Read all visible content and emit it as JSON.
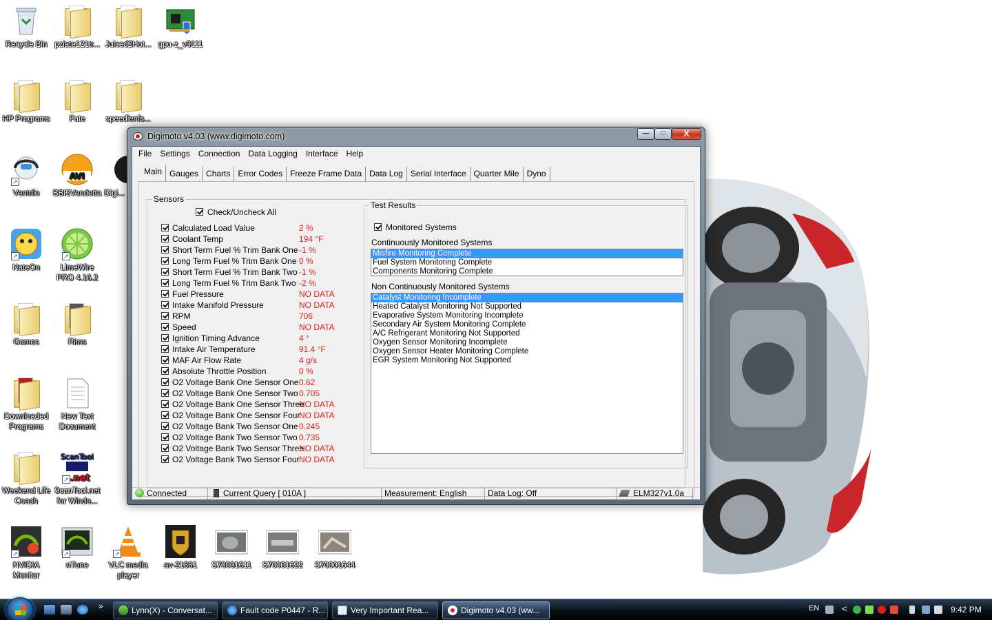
{
  "desktop": {
    "icons": [
      {
        "label": "Recycle Bin"
      },
      {
        "label": "pziate121tr..."
      },
      {
        "label": "Juiced2Hot..."
      },
      {
        "label": "gpu-z_v0111"
      },
      {
        "label": "HP Programs"
      },
      {
        "label": "Fate"
      },
      {
        "label": "speedlenfs..."
      },
      {
        "label": "Ventrilo"
      },
      {
        "label": "BBI2Vendetta"
      },
      {
        "label": "Digi..."
      },
      {
        "label": "NateOn"
      },
      {
        "label": "LimeWire PRO 4.16.2"
      },
      {
        "label": "Games"
      },
      {
        "label": "Rims"
      },
      {
        "label": "Downloaded Programs"
      },
      {
        "label": "New Text Document"
      },
      {
        "label": "Weekend Life Coach"
      },
      {
        "label": "ScanTool.net for Windo..."
      },
      {
        "label": "NVIDIA Monitor"
      },
      {
        "label": "nTune"
      },
      {
        "label": "VLC media player"
      },
      {
        "label": "av-21861"
      },
      {
        "label": "S70001611"
      },
      {
        "label": "S70001622"
      },
      {
        "label": "S70001644"
      }
    ],
    "icon_glyphs": {
      "avi": "AVI",
      "scantool_top": "ScanTool",
      "scantool_bottom": ".net"
    }
  },
  "window": {
    "title": "Digimoto v4.03 (www.digimoto.com)",
    "controls": {
      "minimize": "—",
      "maximize": "□",
      "close": "X"
    }
  },
  "menu": [
    "File",
    "Settings",
    "Connection",
    "Data Logging",
    "Interface",
    "Help"
  ],
  "tabs": [
    "Main",
    "Gauges",
    "Charts",
    "Error Codes",
    "Freeze Frame Data",
    "Data Log",
    "Serial Interface",
    "Quarter Mile",
    "Dyno"
  ],
  "sensors": {
    "group_label": "Sensors",
    "check_all_label": "Check/Uncheck All",
    "items": [
      {
        "name": "Calculated Load Value",
        "value": "2 %"
      },
      {
        "name": "Coolant Temp",
        "value": "194 °F"
      },
      {
        "name": "Short Term Fuel % Trim Bank One",
        "value": "-1 %"
      },
      {
        "name": "Long Term Fuel % Trim Bank One",
        "value": "0 %"
      },
      {
        "name": "Short Term Fuel % Trim Bank Two",
        "value": "-1 %"
      },
      {
        "name": "Long Term Fuel % Trim Bank Two",
        "value": "-2 %"
      },
      {
        "name": "Fuel Pressure",
        "value": "NO DATA"
      },
      {
        "name": "Intake Manifold Pressure",
        "value": "NO DATA"
      },
      {
        "name": "RPM",
        "value": "706"
      },
      {
        "name": "Speed",
        "value": "NO DATA"
      },
      {
        "name": "Ignition Timing Advance",
        "value": "4 °"
      },
      {
        "name": "Intake Air Temperature",
        "value": "91.4 °F"
      },
      {
        "name": "MAF Air Flow Rate",
        "value": "4 g/s"
      },
      {
        "name": "Absolute Throttle Position",
        "value": "0 %"
      },
      {
        "name": "O2 Voltage Bank One Sensor One",
        "value": "0.62"
      },
      {
        "name": "O2 Voltage Bank One Sensor Two",
        "value": "0.705"
      },
      {
        "name": "O2 Voltage Bank One Sensor Three",
        "value": "NO DATA"
      },
      {
        "name": "O2 Voltage Bank One Sensor Four",
        "value": "NO DATA"
      },
      {
        "name": "O2 Voltage Bank Two Sensor One",
        "value": "0.245"
      },
      {
        "name": "O2 Voltage Bank Two Sensor Two",
        "value": "0.735"
      },
      {
        "name": "O2 Voltage Bank Two Sensor Three",
        "value": "NO DATA"
      },
      {
        "name": "O2 Voltage Bank Two Sensor Four",
        "value": "NO DATA"
      }
    ]
  },
  "test_results": {
    "group_label": "Test Results",
    "monitored_label": "Monitored Systems",
    "continuous_label": "Continuously Monitored Systems",
    "continuous": [
      "Misfire Monitoring Complete",
      "Fuel System Monitoring Complete",
      "Components Monitoring Complete"
    ],
    "noncontinuous_label": "Non Continuously Monitored Systems",
    "noncontinuous": [
      "Catalyst Monitoring Incomplete",
      "Heated Catalyst Monitoring Not Supported",
      "Evaporative System Monitoring Incomplete",
      "Secondary Air System Monitoring Complete",
      "A/C Refrigerant Monitoring Not Supported",
      "Oxygen Sensor Monitoring Incomplete",
      "Oxygen Sensor Heater Monitoring Complete",
      "EGR System Monitoring Not Supported"
    ]
  },
  "status_bar": {
    "connection": "Connected",
    "query": "Current Query [ 010A ]",
    "measurement": "Measurement: English",
    "data_log": "Data Log: Off",
    "device": "ELM327v1.0a"
  },
  "taskbar": {
    "quick_launch_chevron": "»",
    "tasks": [
      {
        "label": "Lynn(X) - Conversat..."
      },
      {
        "label": "Fault code P0447 - R..."
      },
      {
        "label": "Very Important Rea..."
      },
      {
        "label": "Digimoto v4.03 (ww..."
      }
    ],
    "language": "EN",
    "tray_chevron": "<",
    "clock": "9:42 PM"
  },
  "colors": {
    "sensor_value": "#e0221d",
    "selection": "#3399ff",
    "taskbar": "#0b1219"
  }
}
